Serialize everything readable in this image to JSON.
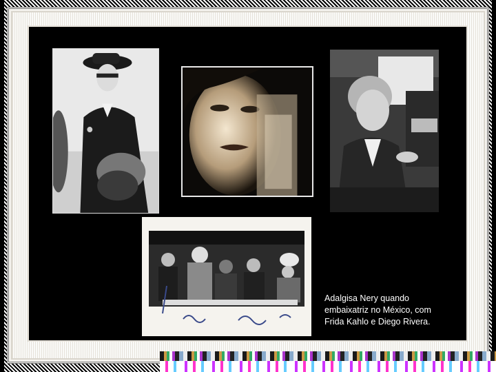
{
  "slide": {
    "caption_lines": [
      "Adalgisa Nery quando",
      "embaixatriz no México, com",
      "Frida Kahlo e Diego Rivera."
    ]
  },
  "photos": [
    {
      "name": "photo-hat-woman",
      "tone": "bw"
    },
    {
      "name": "photo-portrait-face",
      "tone": "sepia"
    },
    {
      "name": "photo-typewriter",
      "tone": "bw"
    },
    {
      "name": "photo-group-dinner",
      "tone": "bw"
    }
  ],
  "colors": {
    "background": "#000000",
    "caption_text": "#ffffff",
    "frame": "#f4f2ee"
  }
}
